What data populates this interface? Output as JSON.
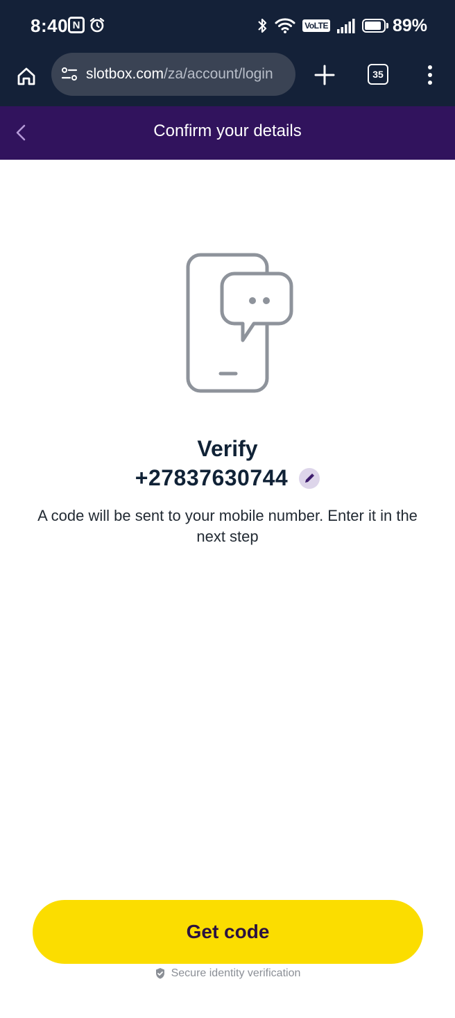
{
  "status_bar": {
    "time": "8:40",
    "nfc_letter": "N",
    "volte_label": "VoLTE",
    "battery_percent": "89%",
    "battery_level": 0.89
  },
  "browser": {
    "url_domain": "slotbox.com",
    "url_path": "/za/account/login",
    "tab_count": "35"
  },
  "header": {
    "title": "Confirm your details"
  },
  "content": {
    "verify_title": "Verify",
    "phone_number": "+27837630744",
    "description": "A code will be sent to your mobile number. Enter it in the next step"
  },
  "footer": {
    "get_code_label": "Get code",
    "secure_note": "Secure identity verification"
  },
  "colors": {
    "status_bg": "#142138",
    "header_bg": "#31135d",
    "primary_button": "#fbdd00",
    "text_dark": "#102236",
    "illustration_stroke": "#8e939b"
  },
  "icons": [
    "home-icon",
    "site-settings-icon",
    "plus-icon",
    "tabs-icon",
    "more-vert-icon",
    "back-chevron-icon",
    "phone-chat-icon",
    "edit-pencil-icon",
    "shield-check-icon",
    "bluetooth-icon",
    "wifi-icon",
    "signal-icon",
    "battery-icon",
    "alarm-icon",
    "nfc-icon"
  ]
}
